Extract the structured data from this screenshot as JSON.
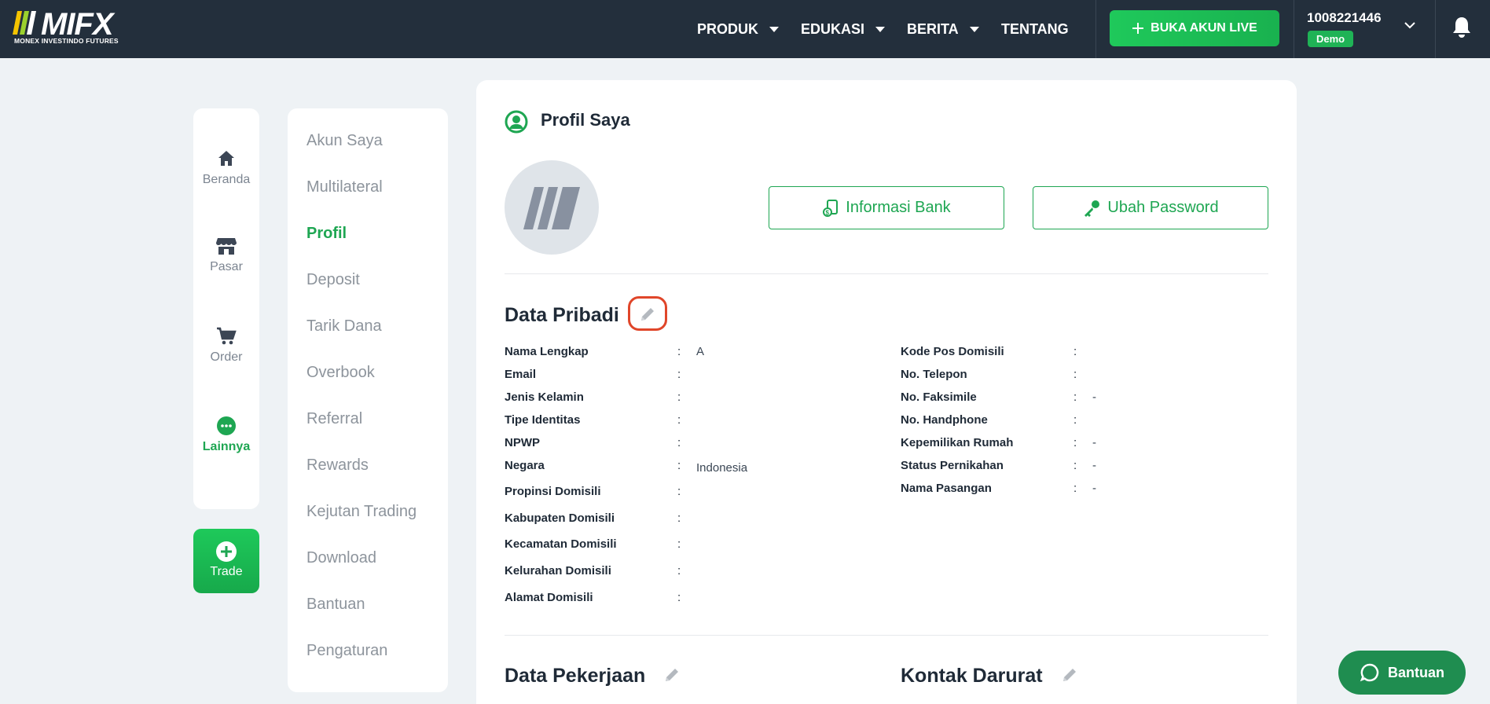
{
  "brand": {
    "name": "MIFX",
    "tagline": "MONEX INVESTINDO FUTURES"
  },
  "nav": {
    "items": [
      {
        "label": "PRODUK",
        "dropdown": true
      },
      {
        "label": "EDUKASI",
        "dropdown": true
      },
      {
        "label": "BERITA",
        "dropdown": true
      },
      {
        "label": "TENTANG",
        "dropdown": false
      }
    ],
    "cta_label": "BUKA AKUN LIVE"
  },
  "account": {
    "number": "1008221446",
    "type": "Demo"
  },
  "rail": {
    "items": [
      {
        "label": "Beranda",
        "icon": "home-icon"
      },
      {
        "label": "Pasar",
        "icon": "store-icon"
      },
      {
        "label": "Order",
        "icon": "cart-icon"
      },
      {
        "label": "Lainnya",
        "icon": "more-icon",
        "active": true
      }
    ],
    "trade_label": "Trade"
  },
  "menu": {
    "items": [
      "Akun Saya",
      "Multilateral",
      "Profil",
      "Deposit",
      "Tarik Dana",
      "Overbook",
      "Referral",
      "Rewards",
      "Kejutan Trading",
      "Download",
      "Bantuan",
      "Pengaturan"
    ],
    "active": "Profil"
  },
  "profile": {
    "title": "Profil Saya",
    "bank_button": "Informasi Bank",
    "password_button": "Ubah Password"
  },
  "personal": {
    "title": "Data Pribadi",
    "left": [
      {
        "label": "Nama Lengkap",
        "value": "A"
      },
      {
        "label": "Email",
        "value": ""
      },
      {
        "label": "Jenis Kelamin",
        "value": ""
      },
      {
        "label": "Tipe Identitas",
        "value": ""
      },
      {
        "label": "NPWP",
        "value": ""
      },
      {
        "label": "Negara",
        "value": "Indonesia"
      },
      {
        "label": "Propinsi Domisili",
        "value": ""
      },
      {
        "label": "Kabupaten Domisili",
        "value": ""
      },
      {
        "label": "Kecamatan Domisili",
        "value": ""
      },
      {
        "label": "Kelurahan Domisili",
        "value": ""
      },
      {
        "label": "Alamat Domisili",
        "value": ""
      }
    ],
    "right": [
      {
        "label": "Kode Pos Domisili",
        "value": ""
      },
      {
        "label": "No. Telepon",
        "value": ""
      },
      {
        "label": "No. Faksimile",
        "value": "-"
      },
      {
        "label": "No. Handphone",
        "value": ""
      },
      {
        "label": "Kepemilikan Rumah",
        "value": "-"
      },
      {
        "label": "Status Pernikahan",
        "value": "-"
      },
      {
        "label": "Nama Pasangan",
        "value": "-"
      }
    ]
  },
  "work": {
    "title": "Data Pekerjaan"
  },
  "emergency": {
    "title": "Kontak Darurat"
  },
  "help": {
    "label": "Bantuan"
  },
  "colors": {
    "accent": "#1ea652",
    "topbar": "#232f3c",
    "highlight": "#e0462a"
  }
}
